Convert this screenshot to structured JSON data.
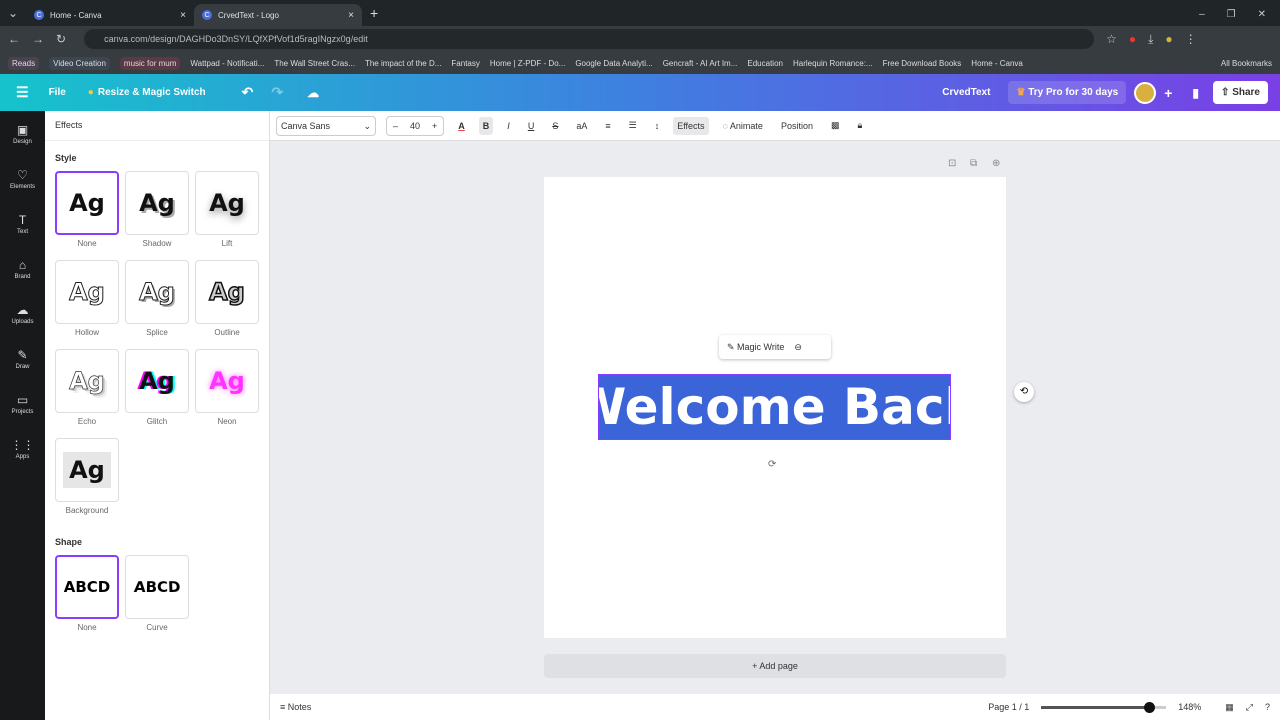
{
  "browser": {
    "tabs": [
      {
        "title": "Home - Canva"
      },
      {
        "title": "CrvedText - Logo"
      }
    ],
    "url": "canva.com/design/DAGHDo3DnSY/LQfXPfVof1d5ragINgzx0g/edit",
    "bookmarks": [
      "Reads",
      "Video Creation",
      "music for mum",
      "Wattpad - Notificati...",
      "The Wall Street Cras...",
      "The impact of the D...",
      "Fantasy",
      "Home | Z-PDF - Do...",
      "Google Data Analyti...",
      "Gencraft - AI Art Im...",
      "Education",
      "Harlequin Romance:...",
      "Free Download Books",
      "Home - Canva"
    ],
    "all_bookmarks": "All Bookmarks"
  },
  "header": {
    "file": "File",
    "resize": "Resize & Magic Switch",
    "design_name": "CrvedText",
    "try_pro": "Try Pro for 30 days",
    "share": "Share"
  },
  "rail": [
    "Design",
    "Elements",
    "Text",
    "Brand",
    "Uploads",
    "Draw",
    "Projects",
    "Apps"
  ],
  "panel": {
    "title": "Effects",
    "style_heading": "Style",
    "styles": [
      "None",
      "Shadow",
      "Lift",
      "Hollow",
      "Splice",
      "Outline",
      "Echo",
      "Glitch",
      "Neon",
      "Background"
    ],
    "selected_style": "None",
    "sample": "Ag",
    "shape_heading": "Shape",
    "shapes": [
      "None",
      "Curve"
    ],
    "shape_sample": "ABCD",
    "selected_shape": "None"
  },
  "toolbar": {
    "font": "Canva Sans",
    "size": "40",
    "effects": "Effects",
    "animate": "Animate",
    "position": "Position"
  },
  "canvas": {
    "text": "Welcome Back",
    "magic_write": "Magic Write",
    "add_page": "+ Add page"
  },
  "footer": {
    "notes": "Notes",
    "page": "Page 1 / 1",
    "zoom": "148%",
    "zoom_value": 148
  }
}
